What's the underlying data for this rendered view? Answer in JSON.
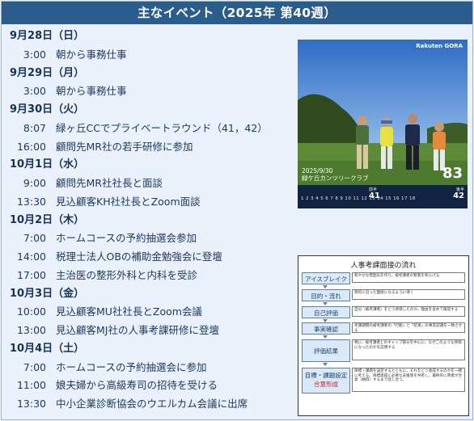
{
  "title": "主なイベント（2025年 第40週）",
  "schedule": [
    {
      "date": "9月28日（日）",
      "events": [
        {
          "time": "3:00",
          "desc": "朝から事務仕事"
        }
      ]
    },
    {
      "date": "9月29日（月）",
      "events": [
        {
          "time": "3:00",
          "desc": "朝から事務仕事"
        }
      ]
    },
    {
      "date": "9月30日（火）",
      "events": [
        {
          "time": "8:07",
          "desc": "緑ヶ丘CCでプライベートラウンド（41，42）"
        },
        {
          "time": "16:00",
          "desc": "顧問先MR社の若手研修に参加"
        }
      ]
    },
    {
      "date": "10月1日（水）",
      "events": [
        {
          "time": "9:00",
          "desc": "顧問先MR社社長と面談"
        },
        {
          "time": "13:30",
          "desc": "見込顧客KH社社長とZoom面談"
        }
      ]
    },
    {
      "date": "10月2日（木）",
      "events": [
        {
          "time": "7:00",
          "desc": "ホームコースの予約抽選会参加"
        },
        {
          "time": "14:00",
          "desc": "税理士法人OBの補助金勉強会に登壇"
        },
        {
          "time": "17:00",
          "desc": "主治医の整形外科と内科を受診"
        }
      ]
    },
    {
      "date": "10月3日（金）",
      "events": [
        {
          "time": "10:00",
          "desc": "見込顧客MU社社長とZoom会議"
        },
        {
          "time": "13:00",
          "desc": "見込顧客MJ社の人事考課研修に登壇"
        }
      ]
    },
    {
      "date": "10月4日（土）",
      "events": [
        {
          "time": "7:00",
          "desc": "ホームコースの予約抽選会に参加"
        },
        {
          "time": "11:00",
          "desc": "娘夫婦から高級寿司の招待を受ける"
        },
        {
          "time": "13:30",
          "desc": "中小企業診断協会のウエルカム会議に出席"
        }
      ]
    }
  ],
  "photo": {
    "brand": "Rakuten GORA",
    "date": "2025/9/30",
    "course": "緑ケ丘カンツリークラブ",
    "score": "83",
    "out_label": "前半",
    "out_score": "41",
    "in_label": "後半",
    "in_score": "42",
    "holes": "1 2 3 4 5 6 7 8 9   10 11 12 13 14 15 16 17 18"
  },
  "flow": {
    "title": "人事考課面接の流れ",
    "steps": [
      {
        "label": "アイスブレイク",
        "desc": "和やかな雰囲気を作り，被考課者の緊張を和らげる"
      },
      {
        "label": "目的・流れ",
        "desc": "目的に沿った面接になるように導く"
      },
      {
        "label": "自己評価",
        "desc": "自分（被考課者）をどう評価したのか，理由を含めて確認する"
      },
      {
        "label": "事実確認",
        "desc": "考課期間の被考課者の「行動」と「結果」の事実認識を一致させる"
      },
      {
        "label": "評価結果",
        "desc": "特に，被考課者とのギャップ部分を中心に，なぜこのような評価になったのかを説明する"
      },
      {
        "label": "目標・課題設定",
        "label2": "合意形成",
        "desc": "目標・課題を設定するとともに，それをどう達成するのかを一緒に考える。目標達成に必要な支援策を共有し，最終的に両者が合意（納得）するまで話し合う。"
      }
    ]
  },
  "colors": {
    "header": "#2b5d8c",
    "accent_red": "#d22020",
    "text": "#1c3a62"
  }
}
